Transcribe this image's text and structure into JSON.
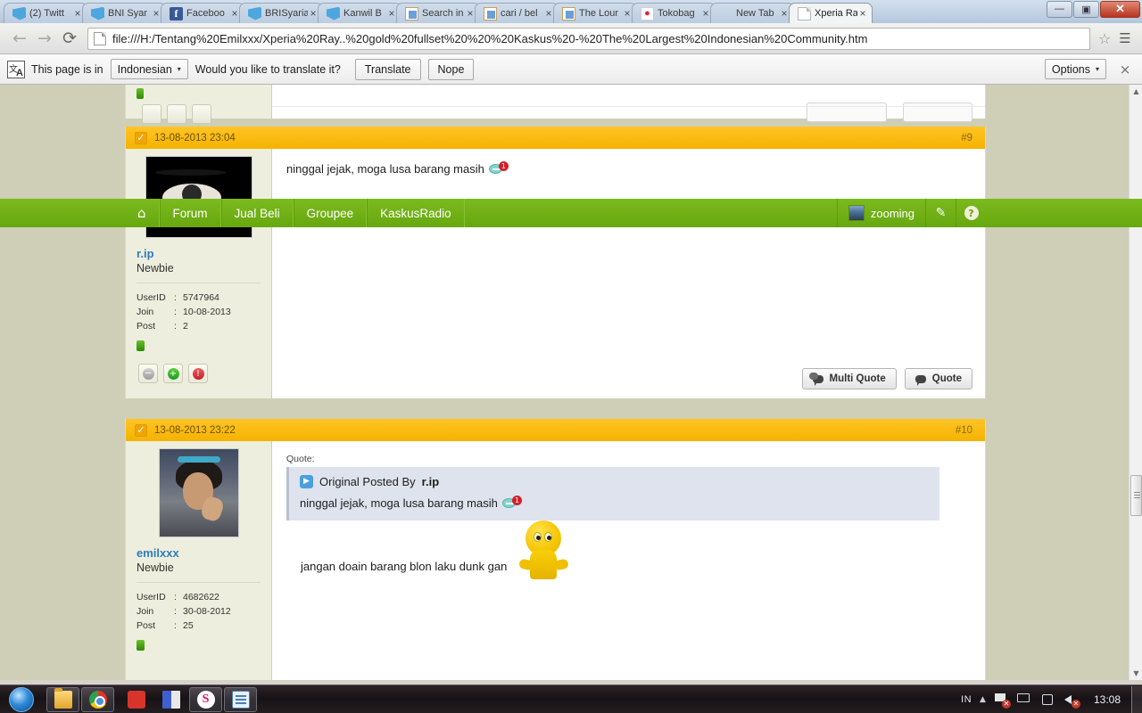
{
  "browser": {
    "tabs": [
      {
        "title": "(2) Twitt",
        "favicon": "twitter-icon",
        "active": false
      },
      {
        "title": "BNI Syar",
        "favicon": "twitter-icon",
        "active": false
      },
      {
        "title": "Faceboo",
        "favicon": "facebook-icon",
        "active": false
      },
      {
        "title": "BRISyaria",
        "favicon": "twitter-icon",
        "active": false
      },
      {
        "title": "Kanwil B",
        "favicon": "twitter-icon",
        "active": false
      },
      {
        "title": "Search in",
        "favicon": "broken-image-icon",
        "active": false
      },
      {
        "title": "cari / bel",
        "favicon": "broken-image-icon",
        "active": false
      },
      {
        "title": "The Lour",
        "favicon": "broken-image-icon",
        "active": false
      },
      {
        "title": "Tokobag",
        "favicon": "tokobagus-icon",
        "active": false
      },
      {
        "title": "New Tab",
        "favicon": "blank-icon",
        "active": false
      },
      {
        "title": "Xperia Ra",
        "favicon": "page-icon",
        "active": true
      }
    ],
    "tab_close_label": "×",
    "window_controls": {
      "minimize": "—",
      "maximize": "▣",
      "close": "✕"
    },
    "toolbar": {
      "back": "←",
      "forward": "→",
      "reload": "⟳",
      "url": "file:///H:/Tentang%20Emilxxx/Xperia%20Ray..%20gold%20fullset%20%20%20Kaskus%20-%20The%20Largest%20Indonesian%20Community.htm",
      "bookmark_star": "☆",
      "menu": "☰"
    },
    "infobar": {
      "icon_primary": "文",
      "icon_secondary": "A",
      "prefix_text": "This page is in",
      "language": "Indonesian",
      "caret": "▾",
      "question_text": "Would you like to translate it?",
      "translate_label": "Translate",
      "nope_label": "Nope",
      "options_label": "Options",
      "options_caret": "▾",
      "close_label": "×"
    }
  },
  "page": {
    "nav": {
      "home_icon": "⌂",
      "items": [
        "Forum",
        "Jual Beli",
        "Groupee",
        "KaskusRadio"
      ],
      "user": "zooming",
      "edit_icon": "✎",
      "help_icon": "?"
    },
    "posts": [
      {
        "date": "13-08-2013 23:04",
        "number": "#9",
        "check_icon": "✓",
        "user": {
          "name": "r.ip",
          "title": "Newbie",
          "stats": [
            {
              "key": "UserID",
              "sep": ":",
              "value": "5747964"
            },
            {
              "key": "Join",
              "sep": ":",
              "value": "10-08-2013"
            },
            {
              "key": "Post",
              "sep": ":",
              "value": "2"
            }
          ],
          "buttons": [
            "mute-icon",
            "reputation-up-icon",
            "report-icon"
          ]
        },
        "text": "ninggal jejak, moga lusa barang masih",
        "actions": [
          {
            "label": "Multi Quote",
            "icon": "multi-quote-icon"
          },
          {
            "label": "Quote",
            "icon": "quote-icon"
          }
        ]
      },
      {
        "date": "13-08-2013 23:22",
        "number": "#10",
        "check_icon": "✓",
        "user": {
          "name": "emilxxx",
          "title": "Newbie",
          "stats": [
            {
              "key": "UserID",
              "sep": ":",
              "value": "4682622"
            },
            {
              "key": "Join",
              "sep": ":",
              "value": "30-08-2012"
            },
            {
              "key": "Post",
              "sep": ":",
              "value": "25"
            }
          ]
        },
        "quote": {
          "label": "Quote:",
          "play_icon": "▶",
          "attribution_prefix": "Original Posted By",
          "attribution_user": "r.ip",
          "text": "ninggal jejak, moga lusa barang masih"
        },
        "text": "jangan doain barang blon laku dunk gan",
        "smiley": "yellow-shrug-smiley"
      }
    ],
    "scrollbar": {
      "up_arrow": "▲",
      "down_arrow": "▼"
    }
  },
  "taskbar": {
    "start_label": "start-orb",
    "pinned": [
      "explorer-icon",
      "chrome-icon",
      "pdf-reader-icon",
      "ebook-icon",
      "smadav-icon",
      "outlook-icon"
    ],
    "tray": {
      "language": "IN",
      "chevron": "▲",
      "network_icon": "network-disconnected-icon",
      "screen_icon": "display-icon",
      "action_icon": "action-center-icon",
      "volume_icon": "volume-muted-icon",
      "clock": "13:08"
    }
  }
}
